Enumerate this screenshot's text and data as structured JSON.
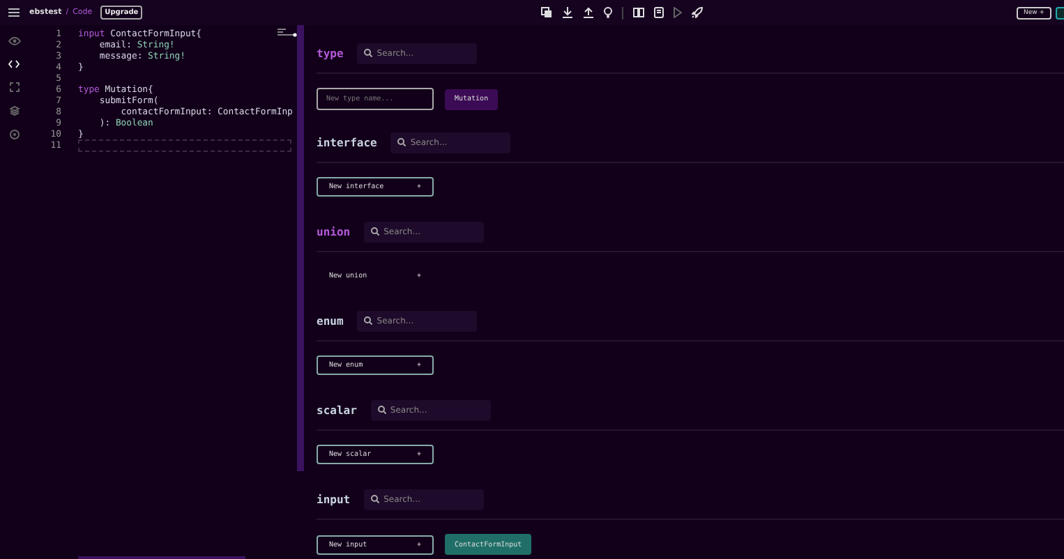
{
  "header": {
    "project": "ebstest",
    "separator": "/",
    "page": "Code",
    "upgrade": "Upgrade",
    "new_button": "New +"
  },
  "code": {
    "lines": [
      {
        "number": "1",
        "tokens": [
          {
            "text": "input ",
            "kind": "keyword"
          },
          {
            "text": "ContactFormInput{",
            "kind": "plain"
          }
        ]
      },
      {
        "number": "2",
        "tokens": [
          {
            "text": "    email: ",
            "kind": "plain"
          },
          {
            "text": "String!",
            "kind": "type"
          }
        ]
      },
      {
        "number": "3",
        "tokens": [
          {
            "text": "    message: ",
            "kind": "plain"
          },
          {
            "text": "String!",
            "kind": "type"
          }
        ]
      },
      {
        "number": "4",
        "tokens": [
          {
            "text": "}",
            "kind": "plain"
          }
        ]
      },
      {
        "number": "5"
      },
      {
        "number": "6",
        "tokens": [
          {
            "text": "type ",
            "kind": "keyword"
          },
          {
            "text": "Mutation{",
            "kind": "plain"
          }
        ]
      },
      {
        "number": "7",
        "tokens": [
          {
            "text": "    submitForm(",
            "kind": "plain"
          }
        ]
      },
      {
        "number": "8",
        "tokens": [
          {
            "text": "        contactFormInput: ContactFormInp",
            "kind": "plain"
          }
        ]
      },
      {
        "number": "9",
        "tokens": [
          {
            "text": "    ): ",
            "kind": "plain"
          },
          {
            "text": "Boolean",
            "kind": "type"
          }
        ]
      },
      {
        "number": "10",
        "tokens": [
          {
            "text": "}",
            "kind": "plain"
          }
        ]
      },
      {
        "number": "11",
        "selected": true
      }
    ]
  },
  "sections": [
    {
      "label": "type",
      "color": "#b35ad8",
      "search_placeholder": "Search...",
      "new": {
        "kind": "field",
        "placeholder": "New type name..."
      },
      "items": [
        {
          "label": "Mutation",
          "color": "#3c0b55"
        }
      ]
    },
    {
      "label": "interface",
      "color": "#c9d4e0",
      "search_placeholder": "Search...",
      "new": {
        "kind": "button",
        "label": "New interface",
        "plus": "+",
        "bordered": true
      }
    },
    {
      "label": "union",
      "color": "#b35ad8",
      "search_placeholder": "Search...",
      "new": {
        "kind": "button",
        "label": "New union",
        "plus": "+",
        "bordered": false
      }
    },
    {
      "label": "enum",
      "color": "#c9d4e0",
      "search_placeholder": "Search...",
      "new": {
        "kind": "button",
        "label": "New enum",
        "plus": "+",
        "bordered": true
      }
    },
    {
      "label": "scalar",
      "color": "#c9d4e0",
      "search_placeholder": "Search...",
      "new": {
        "kind": "button",
        "label": "New scalar",
        "plus": "+",
        "bordered": true
      }
    },
    {
      "label": "input",
      "color": "#c9d4e0",
      "search_placeholder": "Search...",
      "new": {
        "kind": "button",
        "label": "New input",
        "plus": "+",
        "bordered": true
      },
      "items": [
        {
          "label": "ContactFormInput",
          "color": "#1f6f68"
        }
      ]
    }
  ]
}
